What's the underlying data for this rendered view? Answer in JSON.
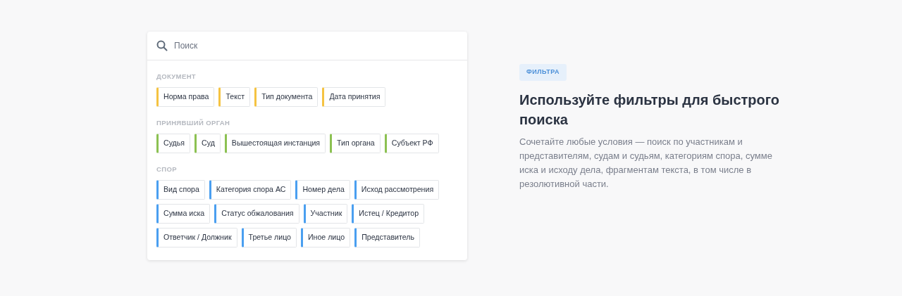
{
  "search": {
    "placeholder": "Поиск"
  },
  "groups": [
    {
      "title": "ДОКУМЕНТ",
      "color": "#f5c342",
      "filters": [
        "Норма права",
        "Текст",
        "Тип документа",
        "Дата принятия"
      ]
    },
    {
      "title": "ПРИНЯВШИЙ ОРГАН",
      "color": "#8cc152",
      "filters": [
        "Судья",
        "Суд",
        "Вышестоящая инстанция",
        "Тип органа",
        "Субъект РФ"
      ]
    },
    {
      "title": "СПОР",
      "color": "#4a9ff0",
      "filters": [
        "Вид спора",
        "Категория спора АС",
        "Номер дела",
        "Исход рассмотрения",
        "Сумма иска",
        "Статус обжалования",
        "Участник",
        "Истец / Кредитор",
        "Ответчик / Должник",
        "Третье лицо",
        "Иное лицо",
        "Представитель"
      ]
    }
  ],
  "info": {
    "badge": "ФИЛЬТРА",
    "heading": "Используйте фильтры для быстрого поиска",
    "text": "Сочетайте любые условия — поиск по участникам и представителям, судам и судьям, категориям спора, сумме иска и исходу дела, фрагментам текста, в том числе в резолютивной части."
  }
}
